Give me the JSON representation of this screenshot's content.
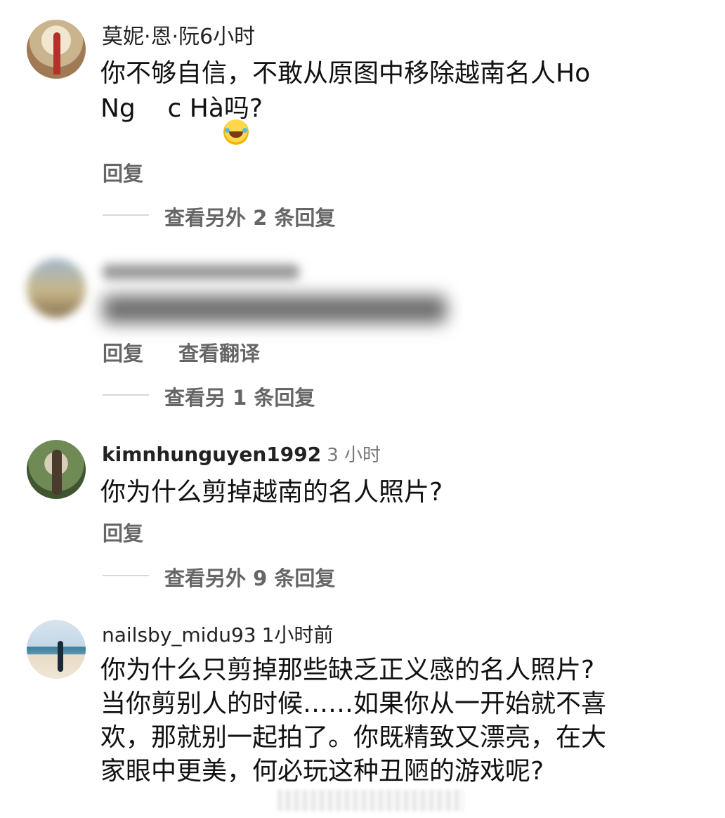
{
  "comments": [
    {
      "username": "莫妮·恩·阮6小时",
      "text_line1": "你不够自信，不敢从原图中移除越南名人Ho",
      "text_line2": "Ng    c Hà吗?",
      "reply": "回复",
      "more_replies": "查看另外 2 条回复"
    },
    {
      "reply": "回复",
      "translate": "查看翻译",
      "more_replies": "查看另 1 条回复"
    },
    {
      "username": "kimnhunguyen1992",
      "time": "3 小时",
      "text": "你为什么剪掉越南的名人照片?",
      "reply": "回复",
      "more_replies": "查看另外 9 条回复"
    },
    {
      "username": "nailsby_midu93",
      "time": "1小时前",
      "text_lines": [
        "你为什么只剪掉那些缺乏正义感的名人照片?",
        "当你剪别人的时候……如果你从一开始就不喜",
        "欢，那就别一起拍了。你既精致又漂亮，在大",
        "家眼中更美，何必玩这种丑陋的游戏呢?"
      ]
    }
  ],
  "icons": {
    "emoji": "laughing-crying-emoji"
  }
}
